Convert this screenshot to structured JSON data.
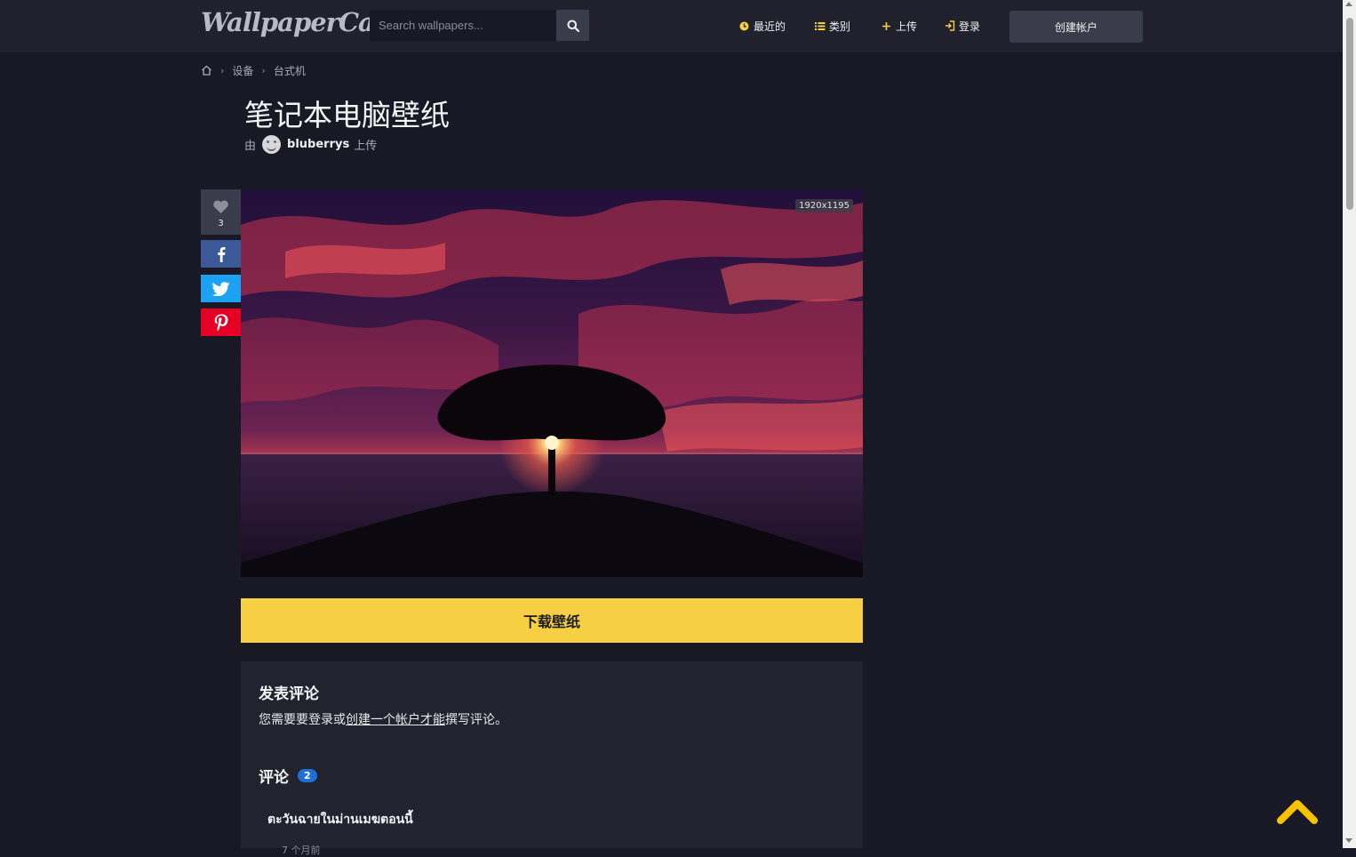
{
  "header": {
    "logo_text": "WallpaperCave",
    "search_placeholder": "Search wallpapers...",
    "nav": {
      "recent": "最近的",
      "categories": "类别",
      "upload": "上传",
      "login": "登录",
      "create_account": "创建帐户"
    }
  },
  "breadcrumb": [
    "设备",
    "台式机"
  ],
  "page": {
    "title": "笔记本电脑壁纸",
    "byline_prefix": "由",
    "uploader": "bluberrys",
    "byline_suffix": "上传"
  },
  "sidebar": {
    "like_count": "3"
  },
  "wallpaper": {
    "resolution": "1920x1195"
  },
  "download_label": "下载壁纸",
  "comments": {
    "post_heading": "发表评论",
    "login_note_pre": "您需要要登录或",
    "login_note_link": "创建一个帐户才能",
    "login_note_post": "撰写评论。",
    "heading": "评论",
    "count": "2",
    "first_comment_text": "ตะวันฉายในม่านเมฆตอนนี้",
    "first_comment_time": "7 个月前"
  },
  "colors": {
    "accent": "#f7cf42",
    "background": "#181924",
    "header": "#20212d",
    "facebook": "#3b5998",
    "twitter": "#1da1f2",
    "pinterest": "#e60023",
    "badge": "#1f6fd6"
  },
  "icons": {
    "search": "search-icon",
    "recent": "clock-icon",
    "categories": "list-icon",
    "upload": "plus-icon",
    "login": "sign-in-icon",
    "home": "home-icon",
    "like": "heart-icon",
    "scroll_top": "chevron-up-icon"
  }
}
